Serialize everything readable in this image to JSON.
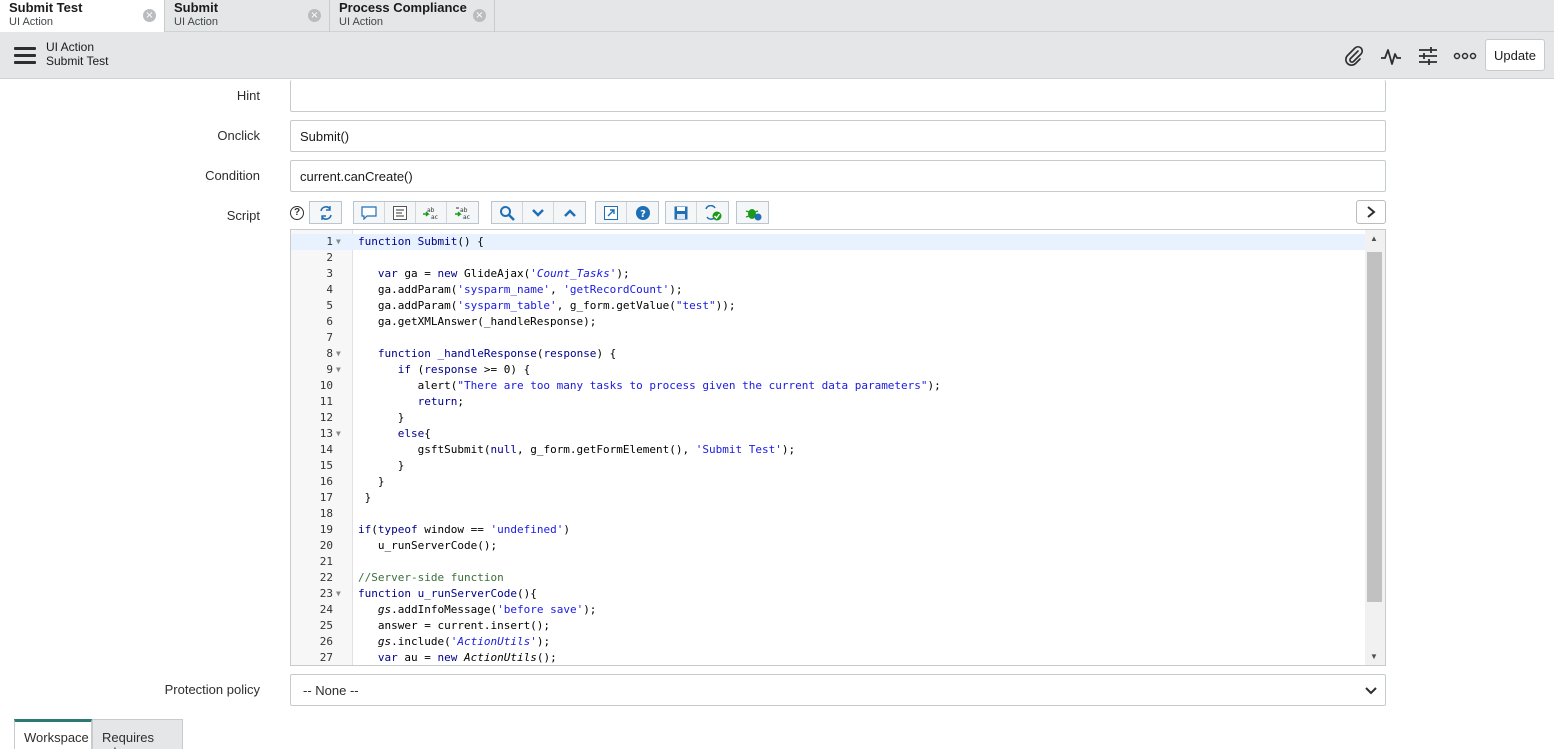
{
  "tabs": [
    {
      "title": "Submit Test",
      "subtitle": "UI Action",
      "close": "×"
    },
    {
      "title": "Submit",
      "subtitle": "UI Action",
      "close": "×"
    },
    {
      "title": "Process Compliance",
      "subtitle": "UI Action",
      "close": "×"
    }
  ],
  "header": {
    "title": "UI Action",
    "subtitle": "Submit Test",
    "icons": [
      "paperclip-icon",
      "activity-icon",
      "sliders-icon",
      "more-icon"
    ],
    "update_label": "Update"
  },
  "form": {
    "hint": {
      "label": "Hint",
      "value": ""
    },
    "onclick": {
      "label": "Onclick",
      "value": "Submit()"
    },
    "condition": {
      "label": "Condition",
      "value": "current.canCreate()"
    },
    "script": {
      "label": "Script",
      "help": "?"
    },
    "protection_policy": {
      "label": "Protection policy",
      "value": "-- None --"
    }
  },
  "script_toolbar": [
    "toggle-syntax-icon",
    "comment-icon",
    "format-icon",
    "replace-icon",
    "replace-all-icon",
    "search-icon",
    "search-next-icon",
    "search-prev-icon",
    "fullscreen-icon",
    "help-icon",
    "save-icon",
    "script-check-icon",
    "debug-icon"
  ],
  "code_lines": [
    "function Submit() {",
    "",
    "   var ga = new GlideAjax('Count_Tasks');",
    "   ga.addParam('sysparm_name', 'getRecordCount');",
    "   ga.addParam('sysparm_table', g_form.getValue(\"test\"));",
    "   ga.getXMLAnswer(_handleResponse);",
    "",
    "   function _handleResponse(response) {",
    "      if (response >= 0) {",
    "         alert(\"There are too many tasks to process given the current data parameters\");",
    "         return;",
    "      }",
    "      else{",
    "         gsftSubmit(null, g_form.getFormElement(), 'Submit Test');",
    "      }",
    "   }",
    " }",
    "",
    "if(typeof window == 'undefined')",
    "   u_runServerCode();",
    "",
    "//Server-side function",
    "function u_runServerCode(){",
    "   gs.addInfoMessage('before save');",
    "   answer = current.insert();",
    "   gs.include('ActionUtils');",
    "   var au = new ActionUtils();"
  ],
  "fold_lines": [
    1,
    8,
    9,
    13,
    23
  ],
  "bottom_tabs": [
    "Workspace",
    "Requires role"
  ]
}
